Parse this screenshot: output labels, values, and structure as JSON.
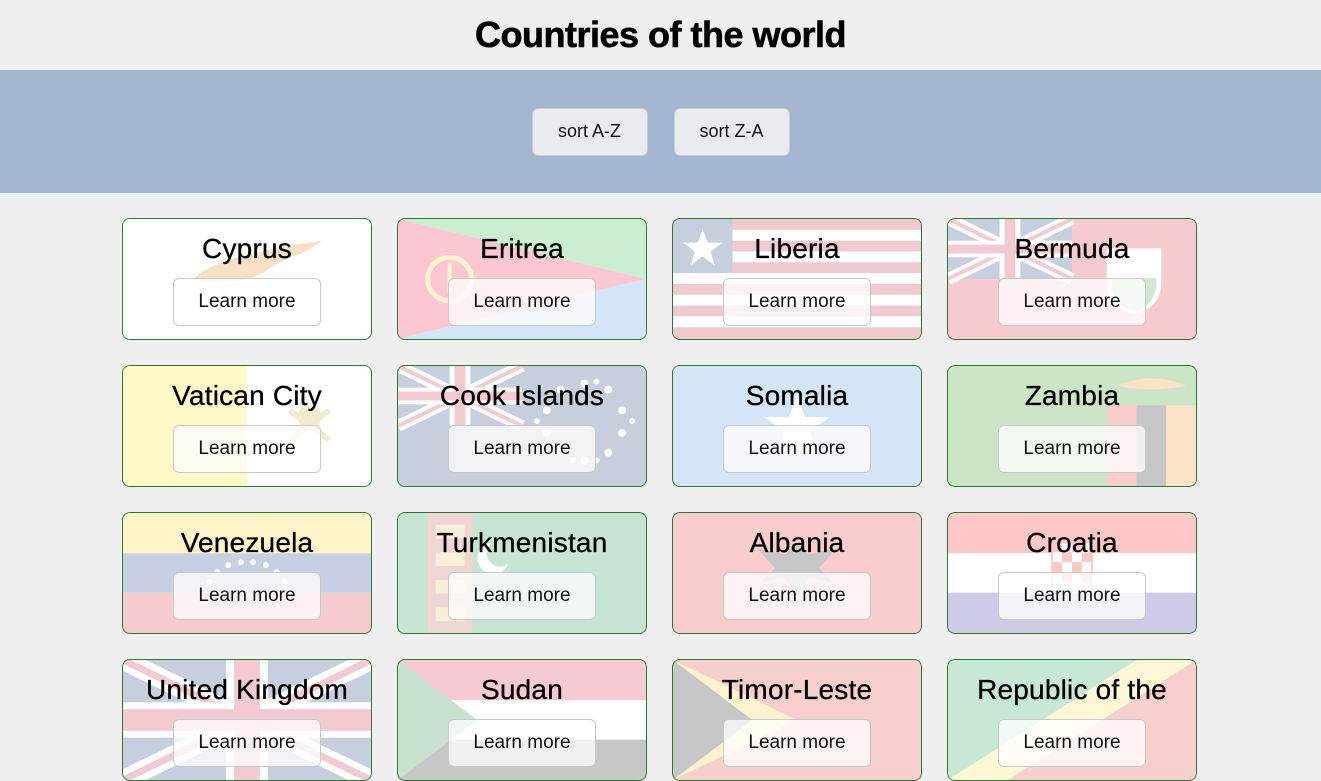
{
  "title": "Countries of the world",
  "toolbar": {
    "sort_az": "sort A-Z",
    "sort_za": "sort Z-A"
  },
  "learn_more": "Learn more",
  "countries": [
    {
      "name": "Cyprus"
    },
    {
      "name": "Eritrea"
    },
    {
      "name": "Liberia"
    },
    {
      "name": "Bermuda"
    },
    {
      "name": "Vatican City"
    },
    {
      "name": "Cook Islands"
    },
    {
      "name": "Somalia"
    },
    {
      "name": "Zambia"
    },
    {
      "name": "Venezuela"
    },
    {
      "name": "Turkmenistan"
    },
    {
      "name": "Albania"
    },
    {
      "name": "Croatia"
    },
    {
      "name": "United Kingdom"
    },
    {
      "name": "Sudan"
    },
    {
      "name": "Timor-Leste"
    },
    {
      "name": "Republic of the"
    }
  ]
}
